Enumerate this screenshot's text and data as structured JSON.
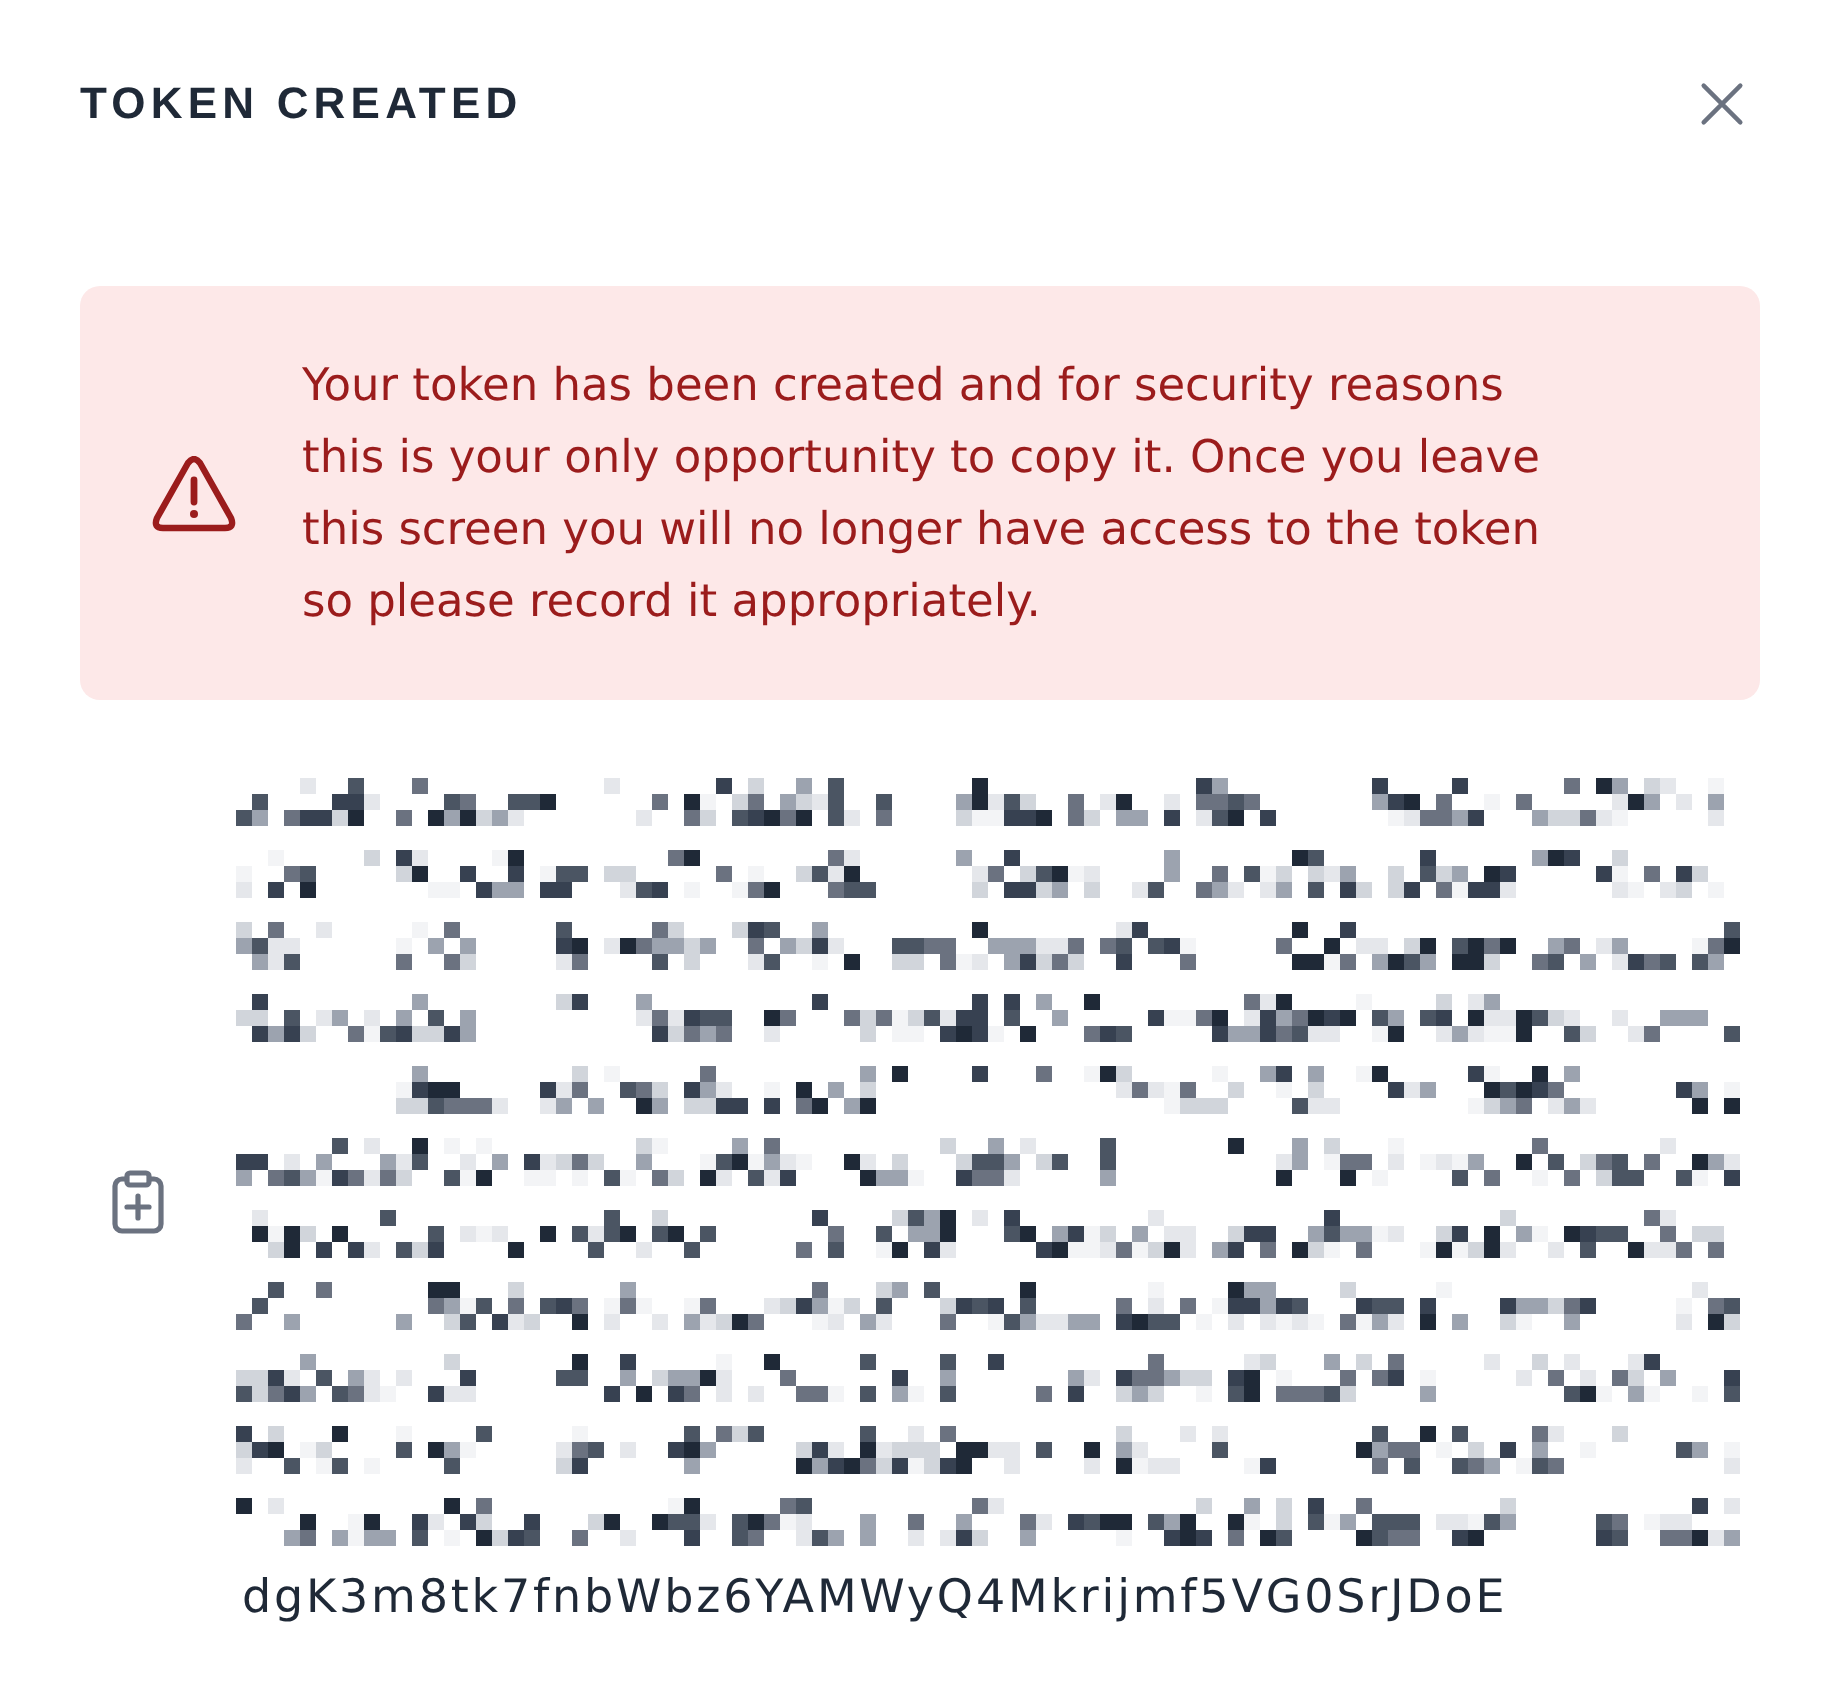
{
  "dialog": {
    "title": "TOKEN CREATED"
  },
  "alert": {
    "kind": "error",
    "message": "Your token has been created and for security reasons this is your only opportunity to copy it. Once you leave this screen you will no longer have access to the token so please record it appropriately."
  },
  "token": {
    "redacted": true,
    "visible_end": "dgK3m8tk7fnbWbz6YAMWyQ4Mkrijmf5VG0SrJDoE"
  }
}
